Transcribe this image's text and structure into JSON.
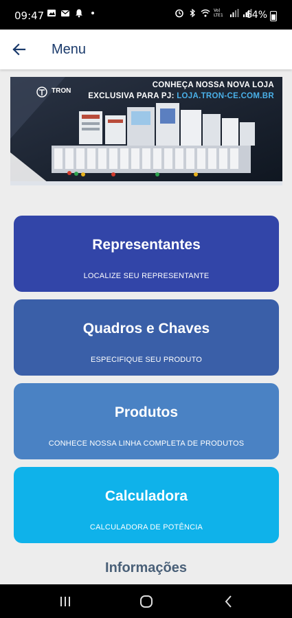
{
  "status_bar": {
    "time": "09:47",
    "battery": "64%",
    "network": "Vo) LTE1"
  },
  "app_bar": {
    "title": "Menu"
  },
  "banner": {
    "brand": "TRON",
    "line1": "CONHEÇA NOSSA NOVA LOJA",
    "line2_prefix": "EXCLUSIVA PARA PJ:",
    "line2_url": "LOJA.TRON-CE.COM.BR"
  },
  "menu": {
    "items": [
      {
        "title": "Representantes",
        "subtitle": "LOCALIZE SEU REPRESENTANTE",
        "color": "#3245a8"
      },
      {
        "title": "Quadros e Chaves",
        "subtitle": "ESPECIFIQUE SEU PRODUTO",
        "color": "#3a5fa8"
      },
      {
        "title": "Produtos",
        "subtitle": "CONHECE NOSSA LINHA COMPLETA DE PRODUTOS",
        "color": "#4a82c4"
      },
      {
        "title": "Calculadora",
        "subtitle": "CALCULADORA DE POTÊNCIA",
        "color": "#0fb2ea"
      }
    ]
  },
  "section": {
    "heading": "Informações"
  },
  "icons": {
    "back": "arrow-left-icon",
    "recents": "recents-icon",
    "home": "home-icon",
    "nav_back": "chevron-left-icon"
  }
}
